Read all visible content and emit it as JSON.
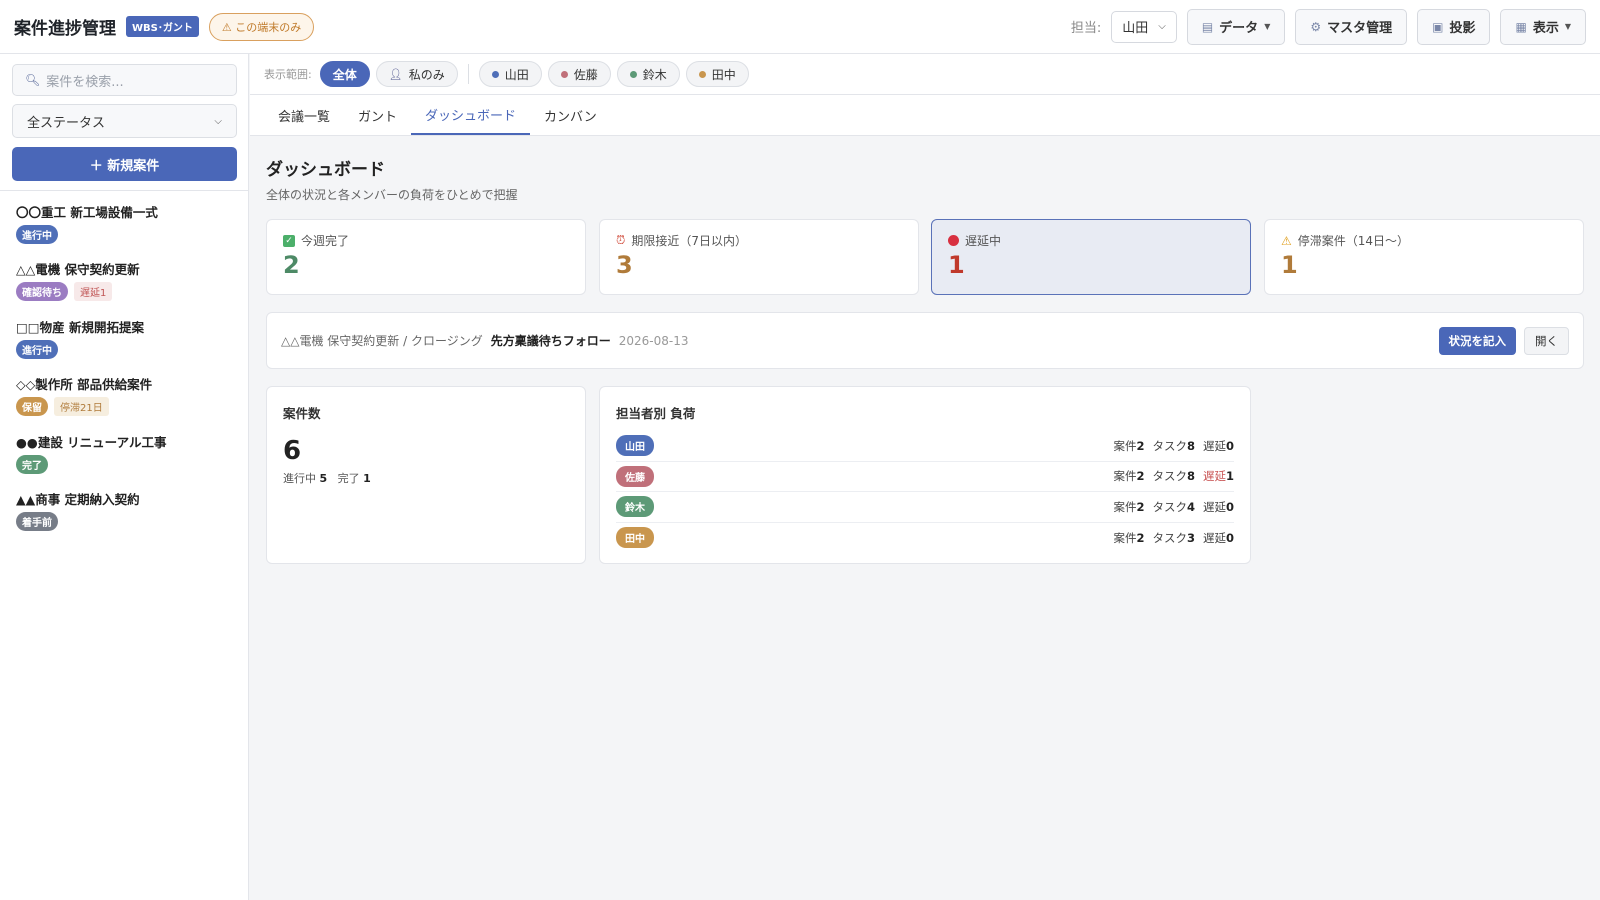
{
  "header": {
    "title": "案件進捗管理",
    "badge_wbs": "WBS･ガント",
    "badge_local": "⚠ この端末のみ",
    "assignee_label": "担当:",
    "assignee_value": "山田",
    "buttons": {
      "data": "データ",
      "master": "マスタ管理",
      "project": "投影",
      "view": "表示"
    }
  },
  "sidebar": {
    "search_placeholder": "案件を検索...",
    "status_filter": "全ステータス",
    "new_button": "＋ 新規案件",
    "projects": [
      {
        "name": "〇〇重工 新工場設備一式",
        "status": "進行中"
      },
      {
        "name": "△△電機 保守契約更新",
        "status": "確認待ち",
        "flag": "遅延1"
      },
      {
        "name": "□□物産 新規開拓提案",
        "status": "進行中"
      },
      {
        "name": "◇◇製作所 部品供給案件",
        "status": "保留",
        "flag": "停滞21日"
      },
      {
        "name": "●●建設 リニューアル工事",
        "status": "完了"
      },
      {
        "name": "▲▲商事 定期納入契約",
        "status": "着手前"
      }
    ]
  },
  "scope": {
    "label": "表示範囲:",
    "all": "全体",
    "mine": "私のみ",
    "members": [
      "山田",
      "佐藤",
      "鈴木",
      "田中"
    ]
  },
  "tabs": [
    "会議一覧",
    "ガント",
    "ダッシュボード",
    "カンバン"
  ],
  "dashboard": {
    "title": "ダッシュボード",
    "subtitle": "全体の状況と各メンバーの負荷をひとめで把握",
    "kpis": [
      {
        "label": "今週完了",
        "value": "2"
      },
      {
        "label": "期限接近（7日以内）",
        "value": "3"
      },
      {
        "label": "遅延中",
        "value": "1"
      },
      {
        "label": "停滞案件（14日〜）",
        "value": "1"
      }
    ],
    "alert": {
      "path": "△△電機 保守契約更新 / クロージング",
      "task": "先方稟議待ちフォロー",
      "date": "2026-08-13",
      "btn_record": "状況を記入",
      "btn_open": "開く"
    },
    "count_card": {
      "title": "案件数",
      "total": "6",
      "in_progress_label": "進行中",
      "in_progress": "5",
      "done_label": "完了",
      "done": "1"
    },
    "load_card": {
      "title": "担当者別 負荷",
      "case_label": "案件",
      "task_label": "タスク",
      "late_label": "遅延",
      "rows": [
        {
          "name": "山田",
          "cases": "2",
          "tasks": "8",
          "late": "0"
        },
        {
          "name": "佐藤",
          "cases": "2",
          "tasks": "8",
          "late": "1"
        },
        {
          "name": "鈴木",
          "cases": "2",
          "tasks": "4",
          "late": "0"
        },
        {
          "name": "田中",
          "cases": "2",
          "tasks": "3",
          "late": "0"
        }
      ]
    }
  },
  "colors": {
    "accent": "#4a67b8",
    "yamada": "#4f6fb8",
    "sato": "#c0707a",
    "suzuki": "#5d9a77",
    "tanaka": "#c9964e",
    "kpi_done": "#4d8a66",
    "kpi_near": "#b07b3a",
    "kpi_late": "#c0392b",
    "kpi_stall": "#b07b3a"
  }
}
